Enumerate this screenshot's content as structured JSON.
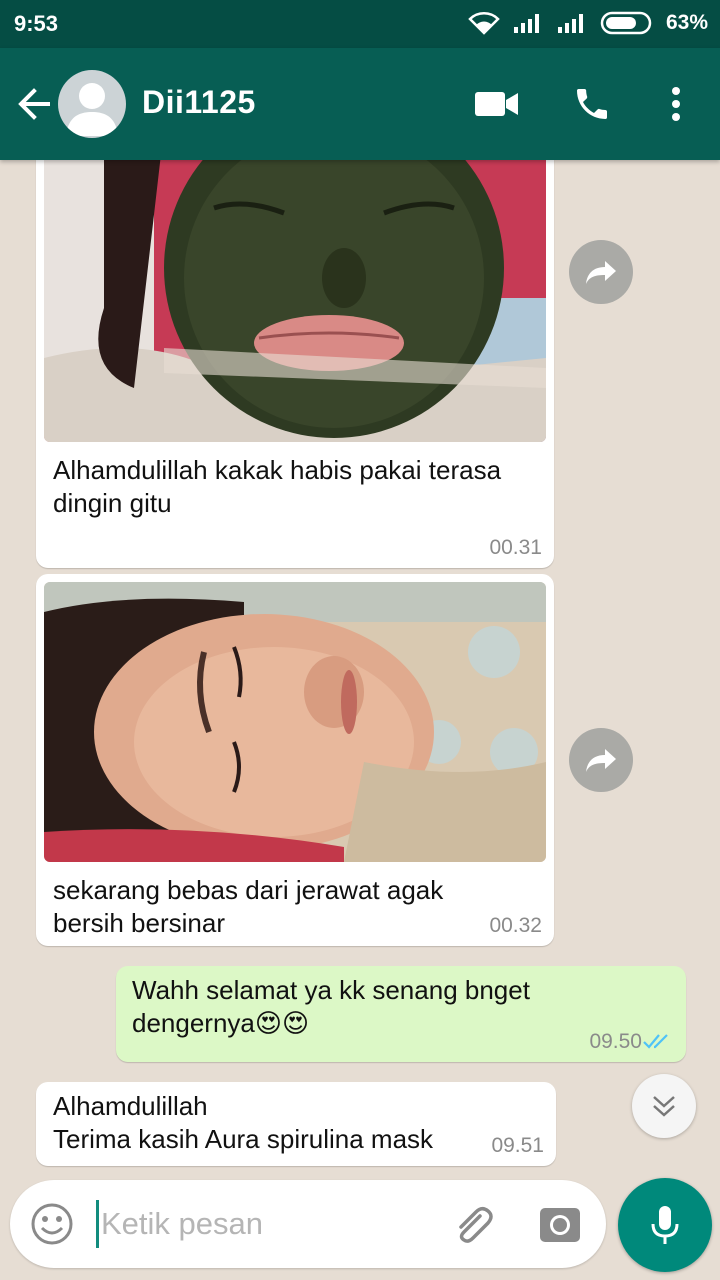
{
  "status_bar": {
    "time": "9:53",
    "battery": "63%"
  },
  "header": {
    "contact_name": "Dii1125"
  },
  "messages": [
    {
      "direction": "incoming",
      "type": "image",
      "caption_lines": [
        "Alhamdulillah kakak habis pakai terasa",
        "dingin gitu"
      ],
      "time": "00.31"
    },
    {
      "direction": "incoming",
      "type": "image",
      "caption_lines": [
        "sekarang bebas dari jerawat agak",
        "bersih bersinar"
      ],
      "time": "00.32"
    },
    {
      "direction": "outgoing",
      "type": "text",
      "text_lines": [
        "Wahh selamat ya kk senang bnget",
        "dengernya😍😍"
      ],
      "time": "09.50",
      "status": "read"
    },
    {
      "direction": "incoming",
      "type": "text",
      "text_lines": [
        "Alhamdulillah",
        "Terima kasih Aura spirulina mask"
      ],
      "time": "09.51"
    }
  ],
  "composer": {
    "placeholder": "Ketik pesan",
    "value": ""
  },
  "colors": {
    "header": "#075e54",
    "status_bar": "#054d44",
    "outgoing_bubble": "#dcf8c6",
    "accent": "#00897b",
    "read_ticks": "#4fc3f7"
  }
}
